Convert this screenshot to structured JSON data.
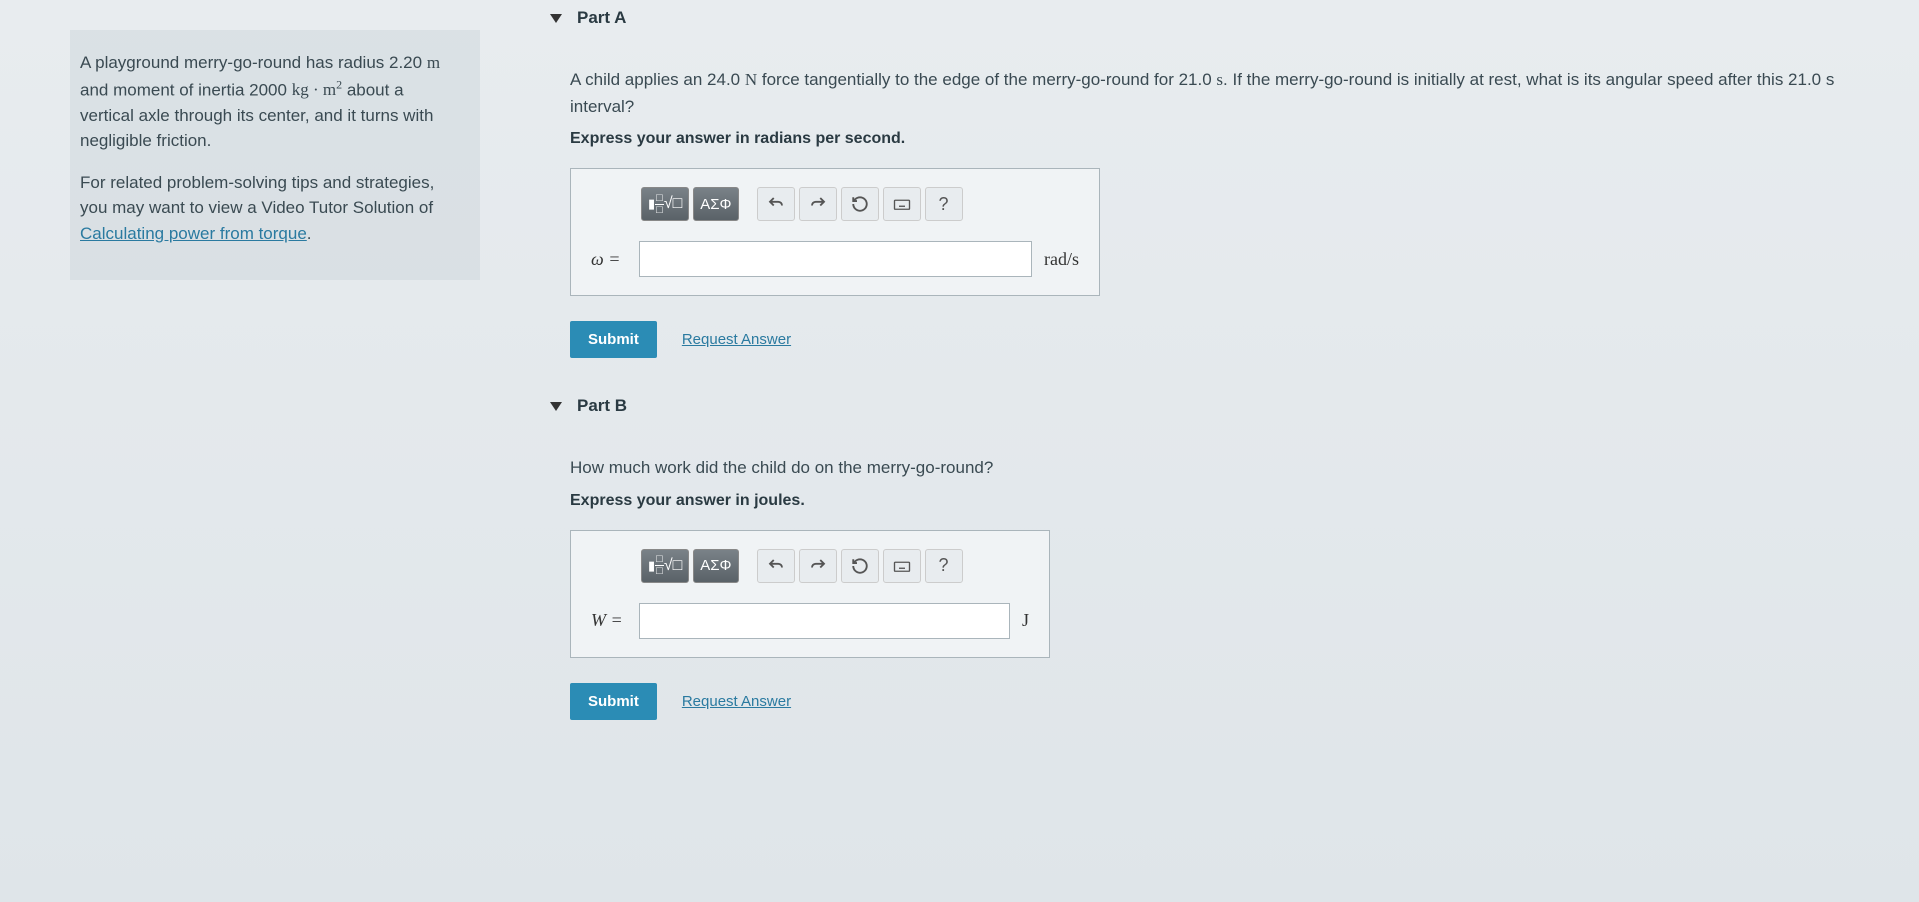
{
  "problem": {
    "paragraph1_pre": "A playground merry-go-round has radius 2.20 ",
    "paragraph1_unit_m": "m",
    "paragraph1_mid": " and moment of inertia 2000 ",
    "paragraph1_unit_kgm2_kg": "kg",
    "paragraph1_unit_kgm2_dot": " · ",
    "paragraph1_unit_kgm2_m": "m",
    "paragraph1_unit_kgm2_exp": "2",
    "paragraph1_post": " about a vertical axle through its center, and it turns with negligible friction.",
    "paragraph2_pre": "For related problem-solving tips and strategies, you may want to view a Video Tutor Solution of ",
    "link_text": "Calculating power from torque",
    "paragraph2_post": "."
  },
  "partA": {
    "title": "Part A",
    "question_pre": "A child applies an 24.0 ",
    "question_unit_N": "N",
    "question_mid": " force tangentially to the edge of the merry-go-round for 21.0 ",
    "question_unit_s": "s",
    "question_post": ". If the merry-go-round is initially at rest, what is its angular speed after this 21.0 s interval?",
    "instruction": "Express your answer in radians per second.",
    "var_label": "ω =",
    "unit": "rad/s",
    "submit": "Submit",
    "request": "Request Answer"
  },
  "partB": {
    "title": "Part B",
    "question": "How much work did the child do on the merry-go-round?",
    "instruction": "Express your answer in joules.",
    "var_label": "W =",
    "unit": "J",
    "submit": "Submit",
    "request": "Request Answer"
  },
  "toolbar": {
    "templates": "■",
    "sqrt": "√",
    "greek": "ΑΣΦ",
    "help": "?"
  }
}
